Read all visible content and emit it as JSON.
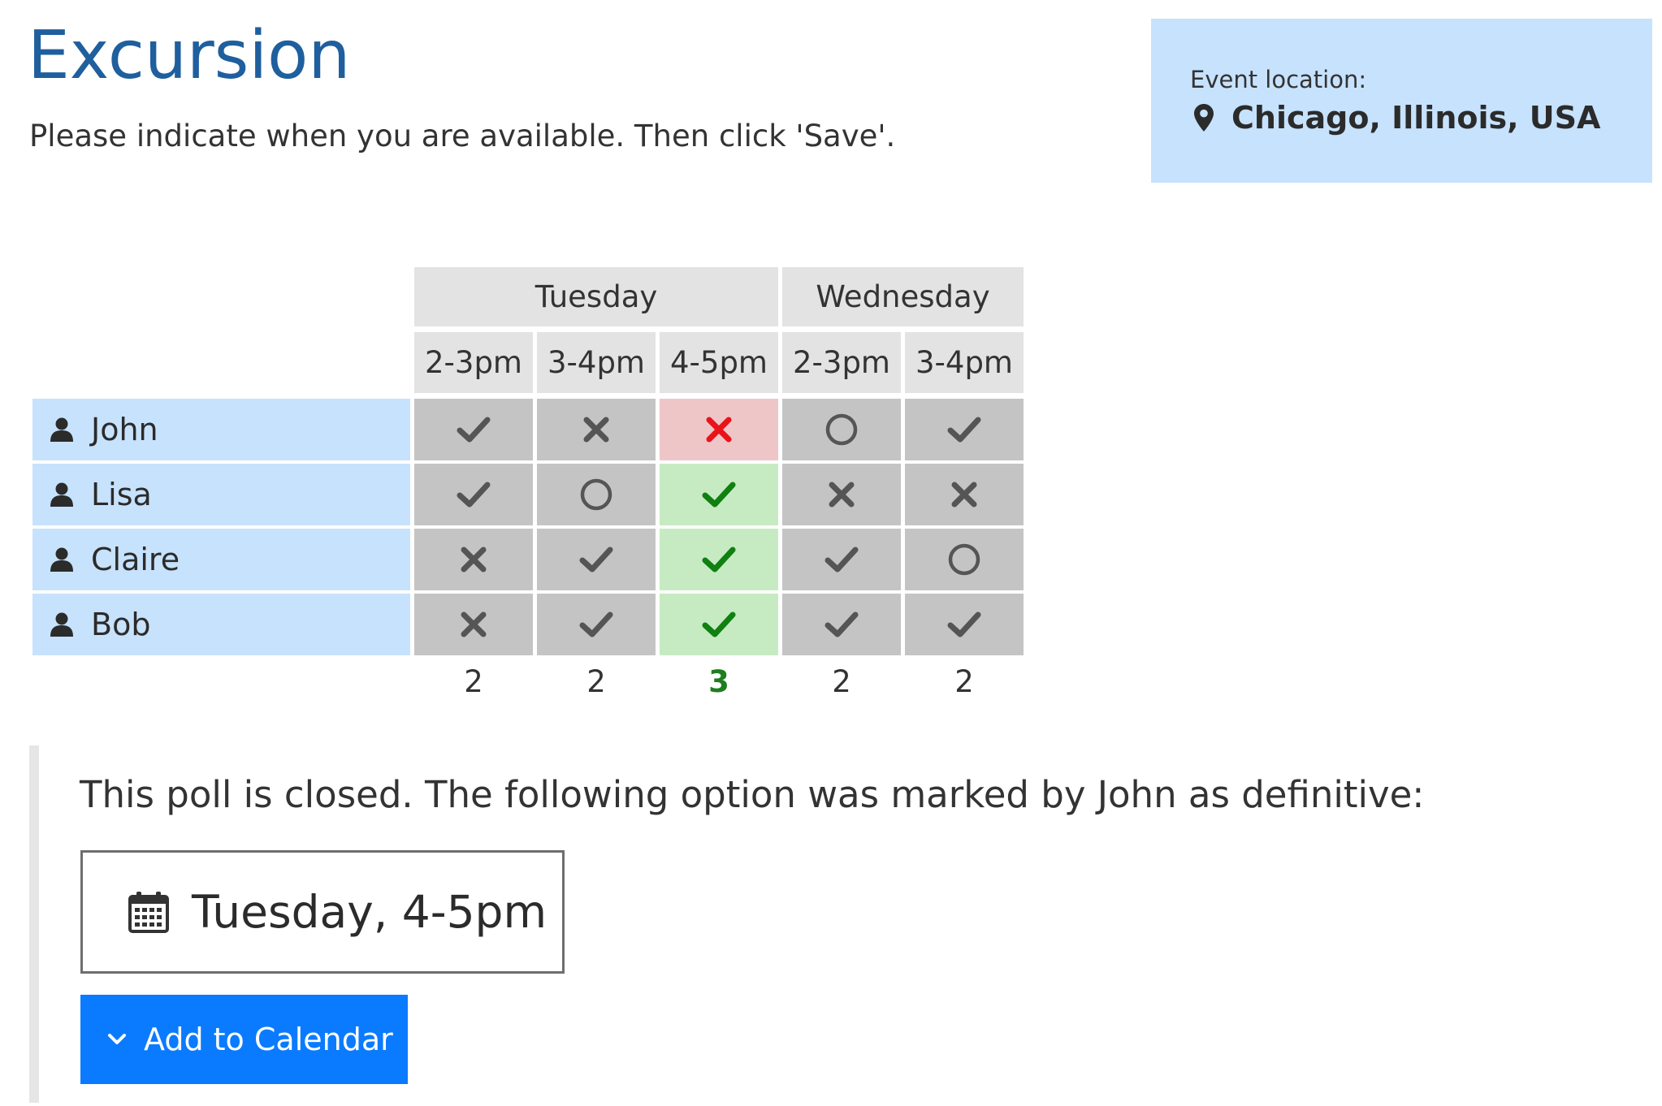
{
  "page": {
    "title": "Excursion",
    "subtitle": "Please indicate when you are available. Then click 'Save'."
  },
  "location": {
    "label": "Event location:",
    "value": "Chicago, Illinois, USA"
  },
  "poll": {
    "days": [
      {
        "label": "Tuesday",
        "span": 3
      },
      {
        "label": "Wednesday",
        "span": 2
      }
    ],
    "slots": [
      "2-3pm",
      "3-4pm",
      "4-5pm",
      "2-3pm",
      "3-4pm"
    ],
    "best_slot_index": 2,
    "participants": [
      {
        "name": "John",
        "votes": [
          "yes",
          "no",
          "no",
          "maybe",
          "yes"
        ]
      },
      {
        "name": "Lisa",
        "votes": [
          "yes",
          "maybe",
          "yes",
          "no",
          "no"
        ]
      },
      {
        "name": "Claire",
        "votes": [
          "no",
          "yes",
          "yes",
          "yes",
          "maybe"
        ]
      },
      {
        "name": "Bob",
        "votes": [
          "no",
          "yes",
          "yes",
          "yes",
          "yes"
        ]
      }
    ],
    "totals": [
      "2",
      "2",
      "3",
      "2",
      "2"
    ]
  },
  "closed": {
    "message": "This poll is closed. The following option was marked by John as definitive:",
    "definitive_option": "Tuesday, 4-5pm",
    "add_to_calendar_label": "Add to Calendar"
  },
  "icons": {
    "location": "map-marker-icon",
    "person": "user-icon",
    "calendar": "calendar-icon",
    "chevron": "chevron-down-icon",
    "yes": "check-icon",
    "no": "cross-icon",
    "maybe": "circle-icon"
  },
  "colors": {
    "title": "#1f5f9e",
    "location_bg": "#c7e2fd",
    "vote_bg": "#c4c4c4",
    "best_yes_bg": "#c6ebc3",
    "best_no_bg": "#eec6c7",
    "best_mark_yes": "#108010",
    "best_mark_no": "#e8141a",
    "mark_default": "#555555",
    "button_bg": "#0a7bff"
  }
}
